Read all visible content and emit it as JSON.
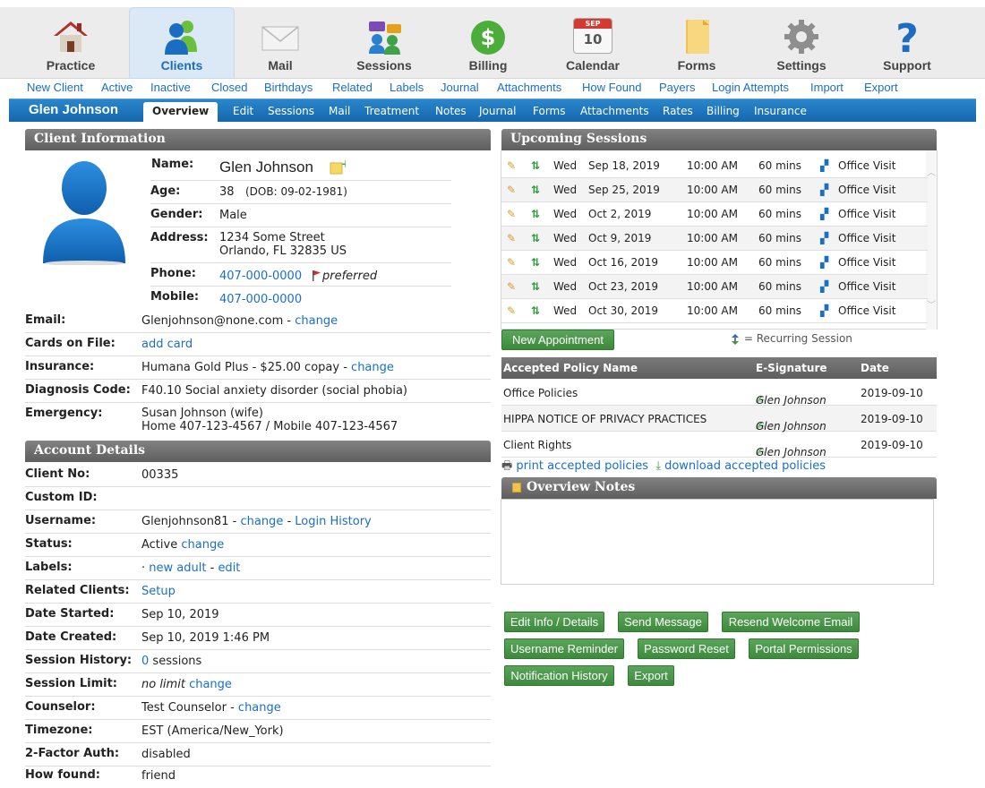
{
  "nav": [
    {
      "label": "Practice",
      "icon": "house-icon"
    },
    {
      "label": "Clients",
      "icon": "clients-icon"
    },
    {
      "label": "Mail",
      "icon": "envelope-icon"
    },
    {
      "label": "Sessions",
      "icon": "sessions-icon"
    },
    {
      "label": "Billing",
      "icon": "dollar-icon"
    },
    {
      "label": "Calendar",
      "icon": "calendar-icon",
      "month": "SEP",
      "day": "10"
    },
    {
      "label": "Forms",
      "icon": "folder-icon"
    },
    {
      "label": "Settings",
      "icon": "gear-icon"
    },
    {
      "label": "Support",
      "icon": "question-icon"
    }
  ],
  "subnav": [
    "New Client",
    "Active",
    "Inactive",
    "Closed",
    "Birthdays",
    "Related",
    "Labels",
    "Journal",
    "Attachments",
    "How Found",
    "Payers",
    "Login Attempts",
    "Import",
    "Export"
  ],
  "client_name": "Glen Johnson",
  "client_tabs": [
    "Overview",
    "Edit",
    "Sessions",
    "Mail",
    "Treatment",
    "Notes",
    "Journal",
    "Forms",
    "Attachments",
    "Rates",
    "Billing",
    "Insurance"
  ],
  "client_info": {
    "title": "Client Information",
    "name_label": "Name:",
    "name": "Glen Johnson",
    "age_label": "Age:",
    "age": "38",
    "dob": "(DOB: 09-02-1981)",
    "gender_label": "Gender:",
    "gender": "Male",
    "address_label": "Address:",
    "address1": "1234 Some Street",
    "address2": "Orlando, FL 32835 US",
    "phone_label": "Phone:",
    "phone": "407-000-0000",
    "phone_note": "preferred",
    "mobile_label": "Mobile:",
    "mobile": "407-000-0000",
    "email_label": "Email:",
    "email": "Glenjohnson@none.com",
    "change": "change",
    "sep": "-",
    "cards_label": "Cards on File:",
    "cards": "add card",
    "insurance_label": "Insurance:",
    "insurance": "Humana Gold Plus - $25.00 copay",
    "diag_label": "Diagnosis Code:",
    "diag": "F40.10 Social anxiety disorder (social phobia)",
    "emerg_label": "Emergency:",
    "emerg1": "Susan Johnson (wife)",
    "emerg2": "Home 407-123-4567 / Mobile 407-123-4567"
  },
  "account": {
    "title": "Account Details",
    "rows": [
      {
        "label": "Client No:",
        "value": "00335"
      },
      {
        "label": "Custom ID:",
        "value": ""
      },
      {
        "label": "Username:",
        "value": "Glenjohnson81",
        "l1": "change",
        "l2": "Login History"
      },
      {
        "label": "Status:",
        "value": "Active",
        "l1": "change"
      },
      {
        "label": "Labels:",
        "value": "·",
        "l1": "new adult",
        "l2": "edit"
      },
      {
        "label": "Related Clients:",
        "l1": "Setup"
      },
      {
        "label": "Date Started:",
        "value": "Sep 10, 2019"
      },
      {
        "label": "Date Created:",
        "value": "Sep 10, 2019 1:46 PM"
      },
      {
        "label": "Session History:",
        "l1": "0",
        "value": "sessions"
      },
      {
        "label": "Session Limit:",
        "value": "no limit",
        "l1": "change"
      },
      {
        "label": "Counselor:",
        "value": "Test Counselor",
        "l1": "change"
      },
      {
        "label": "Timezone:",
        "value": "EST (America/New_York)"
      },
      {
        "label": "2-Factor Auth:",
        "value": "disabled"
      },
      {
        "label": "How found:",
        "value": "friend"
      }
    ]
  },
  "sessions": {
    "title": "Upcoming Sessions",
    "rows": [
      {
        "day": "Wed",
        "date": "Sep 18, 2019",
        "time": "10:00 AM",
        "dur": "60 mins",
        "type": "Office Visit"
      },
      {
        "day": "Wed",
        "date": "Sep 25, 2019",
        "time": "10:00 AM",
        "dur": "60 mins",
        "type": "Office Visit"
      },
      {
        "day": "Wed",
        "date": "Oct 2, 2019",
        "time": "10:00 AM",
        "dur": "60 mins",
        "type": "Office Visit"
      },
      {
        "day": "Wed",
        "date": "Oct 9, 2019",
        "time": "10:00 AM",
        "dur": "60 mins",
        "type": "Office Visit"
      },
      {
        "day": "Wed",
        "date": "Oct 16, 2019",
        "time": "10:00 AM",
        "dur": "60 mins",
        "type": "Office Visit"
      },
      {
        "day": "Wed",
        "date": "Oct 23, 2019",
        "time": "10:00 AM",
        "dur": "60 mins",
        "type": "Office Visit"
      },
      {
        "day": "Wed",
        "date": "Oct 30, 2019",
        "time": "10:00 AM",
        "dur": "60 mins",
        "type": "Office Visit"
      }
    ],
    "new_appt": "New Appointment",
    "legend": "= Recurring Session"
  },
  "policies": {
    "headers": [
      "Accepted Policy Name",
      "E-Signature",
      "Date"
    ],
    "rows": [
      {
        "name": "Office Policies",
        "sig": "Glen Johnson",
        "date": "2019-09-10"
      },
      {
        "name": "HIPPA NOTICE OF PRIVACY PRACTICES",
        "sig": "Glen Johnson",
        "date": "2019-09-10"
      },
      {
        "name": "Client Rights",
        "sig": "Glen Johnson",
        "date": "2019-09-10"
      }
    ],
    "print": "print accepted policies",
    "download": "download accepted policies"
  },
  "notes_title": "Overview Notes",
  "buttons": [
    "Edit Info / Details",
    "Send Message",
    "Resend Welcome Email",
    "Username Reminder",
    "Password Reset",
    "Portal Permissions",
    "Notification History",
    "Export"
  ],
  "colors": {
    "accent": "#1a6fc4",
    "header_gray": "#6e6e6e",
    "button_green": "#4a984a",
    "clientbar_blue": "#1e77bd"
  }
}
